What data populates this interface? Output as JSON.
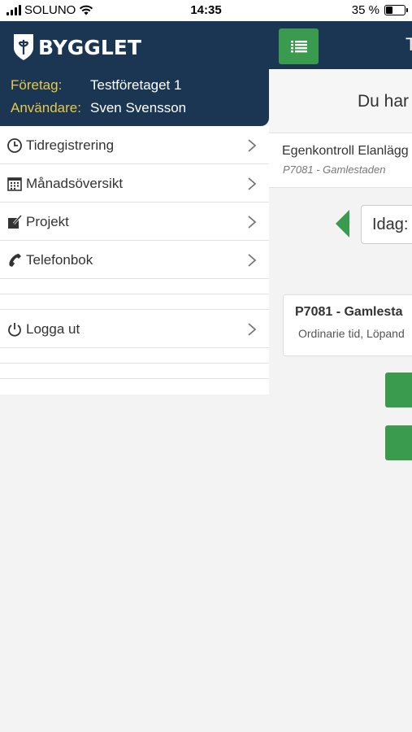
{
  "status_bar": {
    "carrier": "SOLUNO",
    "time": "14:35",
    "battery_percent": "35 %",
    "battery_level": 0.35
  },
  "brand": {
    "name": "BYGGLET",
    "primary_color": "#1a3652",
    "accent_color": "#3a9a4e",
    "label_color": "#e6c84a"
  },
  "drawer": {
    "company_label": "Företag:",
    "company_value": "Testföretaget 1",
    "user_label": "Användare:",
    "user_value": "Sven Svensson",
    "items": [
      {
        "label": "Tidregistrering",
        "icon": "clock-icon"
      },
      {
        "label": "Månadsöversikt",
        "icon": "calendar-icon"
      },
      {
        "label": "Projekt",
        "icon": "edit-icon"
      },
      {
        "label": "Telefonbok",
        "icon": "phone-icon"
      }
    ],
    "logout_label": "Logga ut",
    "logout_icon": "power-icon"
  },
  "main": {
    "header_title": "T",
    "greeting": "Du har",
    "project_name": "Egenkontroll Elanlägg",
    "project_sub": "P7081 - Gamlestaden",
    "date_label": "Idag:",
    "entry_title": "P7081 - Gamlesta",
    "entry_sub": "Ordinarie tid, Löpand"
  }
}
